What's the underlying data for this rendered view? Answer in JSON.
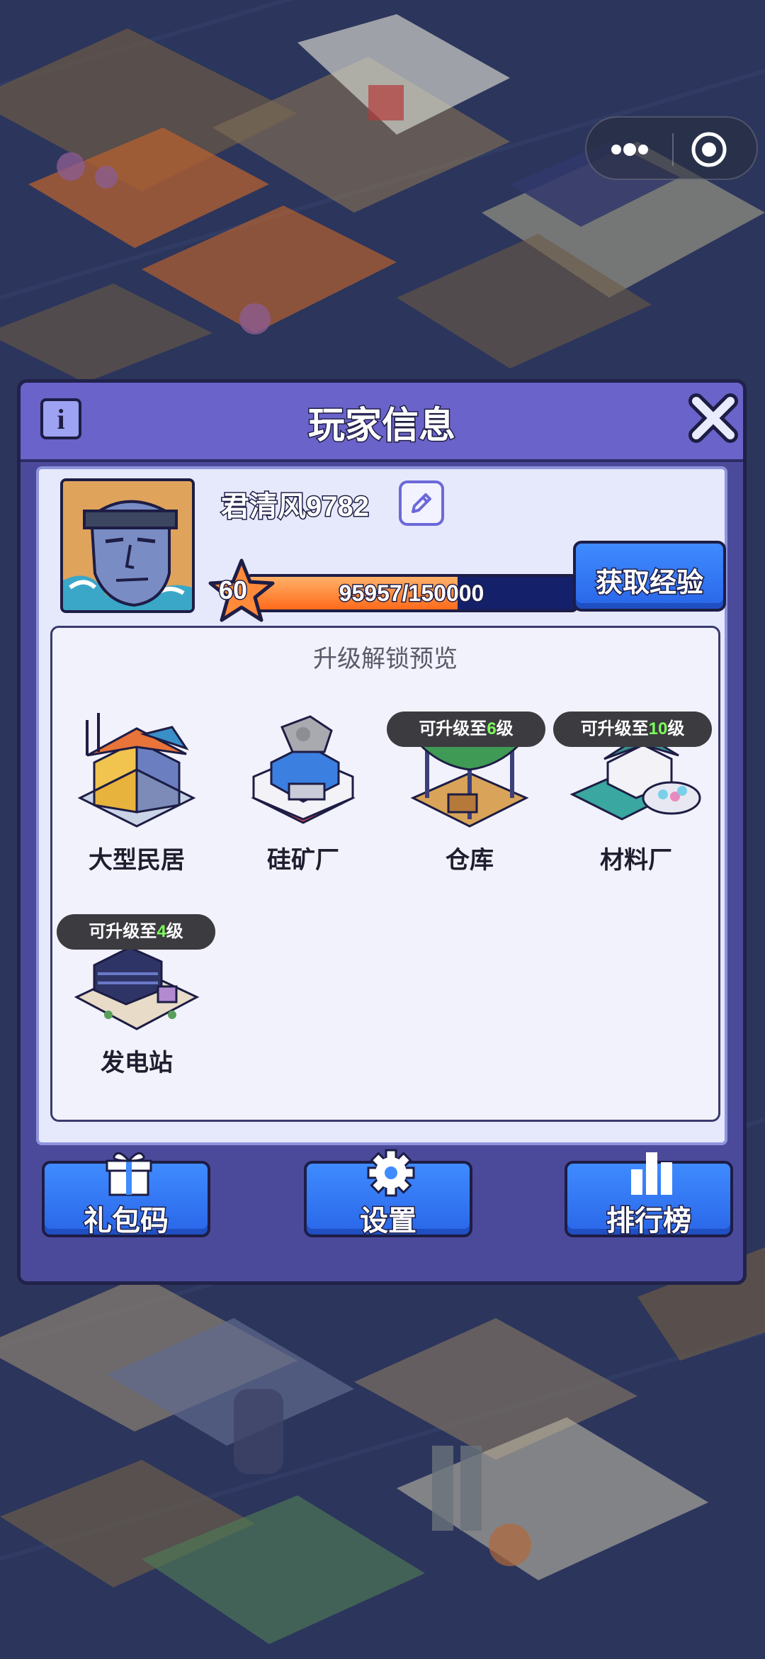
{
  "dialog": {
    "title": "玩家信息"
  },
  "player": {
    "name": "君清风9782",
    "level": "60",
    "exp_text": "95957/150000",
    "exp_progress": 0.6397
  },
  "get_exp_button": "获取经验",
  "preview": {
    "title": "升级解锁预览",
    "items": [
      {
        "label": "大型民居"
      },
      {
        "label": "硅矿厂"
      },
      {
        "label": "仓库",
        "badge_prefix": "可升级至",
        "badge_level": "6",
        "badge_suffix": "级"
      },
      {
        "label": "材料厂",
        "badge_prefix": "可升级至",
        "badge_level": "10",
        "badge_suffix": "级"
      },
      {
        "label": "发电站",
        "badge_prefix": "可升级至",
        "badge_level": "4",
        "badge_suffix": "级"
      }
    ]
  },
  "bottom_buttons": [
    {
      "label": "礼包码",
      "icon": "gift-icon"
    },
    {
      "label": "设置",
      "icon": "gear-icon"
    },
    {
      "label": "排行榜",
      "icon": "leaderboard-icon"
    }
  ],
  "colors": {
    "dialog_header": "#6a63c9",
    "dialog_body": "#4b4a9a",
    "panel": "#e6e9fb",
    "button_blue": "#3f8bff",
    "exp_orange": "#ff6b1b",
    "level_highlight": "#7cff5a"
  }
}
